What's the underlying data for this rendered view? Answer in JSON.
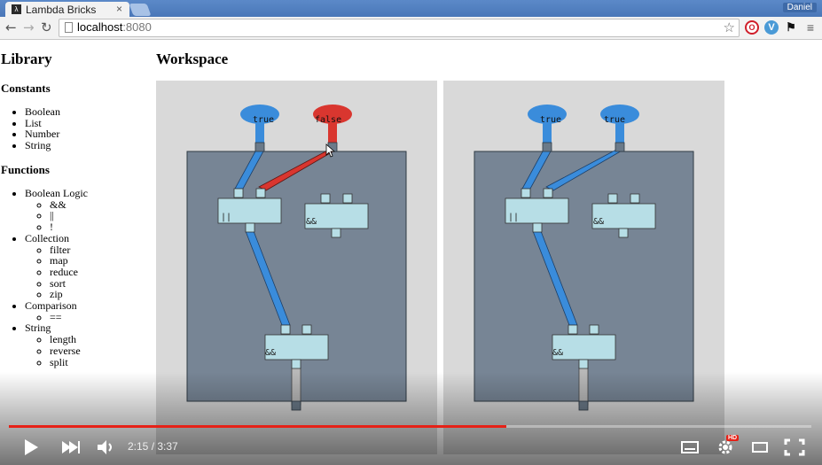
{
  "browser": {
    "tab_title": "Lambda Bricks",
    "tab_close": "×",
    "profile_name": "Daniel",
    "url_host": "localhost",
    "url_port": ":8080"
  },
  "library": {
    "title": "Library",
    "constants_title": "Constants",
    "constants": [
      "Boolean",
      "List",
      "Number",
      "String"
    ],
    "functions_title": "Functions",
    "functions": [
      {
        "label": "Boolean Logic",
        "items": [
          "&&",
          "||",
          "!"
        ]
      },
      {
        "label": "Collection",
        "items": [
          "filter",
          "map",
          "reduce",
          "sort",
          "zip"
        ]
      },
      {
        "label": "Comparison",
        "items": [
          "=="
        ]
      },
      {
        "label": "String",
        "items": [
          "length",
          "reverse",
          "split"
        ]
      }
    ]
  },
  "workspace": {
    "title": "Workspace",
    "panels": [
      {
        "input_a": "true",
        "input_b": "false",
        "top_left_brick": "||",
        "right_brick": "&&",
        "bottom_brick": "&&"
      },
      {
        "input_a": "true",
        "input_b": "true",
        "top_left_brick": "||",
        "right_brick": "&&",
        "bottom_brick": "&&"
      }
    ]
  },
  "video": {
    "time": "2:15 / 3:37",
    "progress": 0.62,
    "hd_badge": "HD"
  },
  "colors": {
    "true_blue": "#3a8cdb",
    "false_red": "#d9362f",
    "brick": "#b7dee6",
    "panel_bg": "#778595",
    "progress": "#e62117"
  }
}
